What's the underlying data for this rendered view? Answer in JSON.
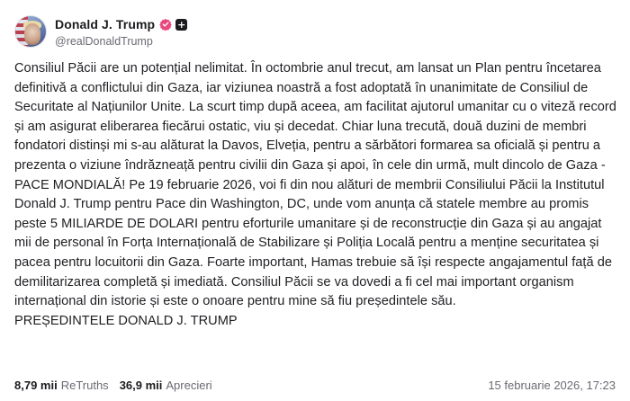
{
  "author": {
    "display_name": "Donald J. Trump",
    "handle": "@realDonaldTrump",
    "verified_icon": "verified-badge-icon",
    "plus_icon_glyph": "+"
  },
  "post": {
    "text": "Consiliul Păcii are un potențial nelimitat. În octombrie anul trecut, am lansat un Plan pentru încetarea definitivă a conflictului din Gaza, iar viziunea noastră a fost adoptată în unanimitate de Consiliul de Securitate al Națiunilor Unite. La scurt timp după aceea, am facilitat ajutorul umanitar cu o viteză record și am asigurat eliberarea fiecărui ostatic, viu și decedat. Chiar luna trecută, două duzini de membri fondatori distinși mi s-au alăturat la Davos, Elveția, pentru a sărbători formarea sa oficială și pentru a prezenta o viziune îndrăzneață pentru civilii din Gaza și apoi, în cele din urmă, mult dincolo de Gaza - PACE MONDIALĂ! Pe 19 februarie 2026, voi fi din nou alături de membrii Consiliului Păcii la Institutul Donald J. Trump pentru Pace din Washington, DC, unde vom anunța că statele membre au promis peste 5 MILIARDE DE DOLARI pentru eforturile umanitare și de reconstrucție din Gaza și au angajat mii de personal în Forța Internațională de Stabilizare și Poliția Locală pentru a menține securitatea și pacea pentru locuitorii din Gaza. Foarte important, Hamas trebuie să își respecte angajamentul față de demilitarizarea completă și imediată. Consiliul Păcii se va dovedi a fi cel mai important organism internațional din istorie și este o onoare pentru mine să fiu președintele său.",
    "signature": "PREȘEDINTELE DONALD J. TRUMP"
  },
  "stats": {
    "retruths_count": "8,79 mii",
    "retruths_label": "ReTruths",
    "likes_count": "36,9 mii",
    "likes_label": "Aprecieri"
  },
  "timestamp": "15 februarie 2026, 17:23",
  "colors": {
    "verified_badge": "#e8487f",
    "text_primary": "#1f1f23",
    "text_secondary": "#6a6a73"
  }
}
